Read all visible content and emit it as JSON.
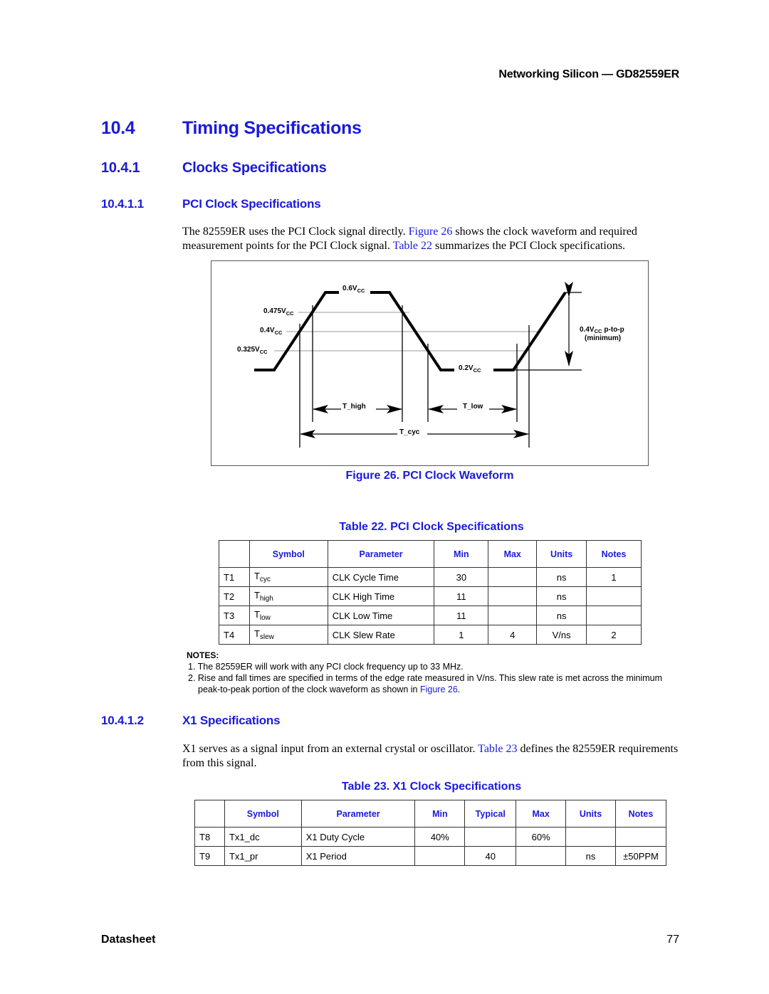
{
  "header": {
    "running_title": "Networking Silicon — GD82559ER"
  },
  "section": {
    "number": "10.4",
    "title": "Timing Specifications"
  },
  "subsection": {
    "number": "10.4.1",
    "title": "Clocks Specifications"
  },
  "subsubsections": [
    {
      "number": "10.4.1.1",
      "title": "PCI Clock Specifications",
      "paragraph": {
        "part1": "The 82559ER uses the PCI Clock signal directly. ",
        "link1": "Figure 26",
        "part2": " shows the clock waveform and required measurement points for the PCI Clock signal. ",
        "link2": "Table 22",
        "part3": " summarizes the PCI Clock specifications."
      }
    },
    {
      "number": "10.4.1.2",
      "title": "X1 Specifications",
      "paragraph": {
        "part1": "X1 serves as a signal input from an external crystal or oscillator. ",
        "link1": "Table 23",
        "part2": " defines the 82559ER requirements from this signal."
      }
    }
  ],
  "figure": {
    "caption": "Figure 26. PCI Clock Waveform",
    "labels": {
      "v_high": "0.6V",
      "v_0475": "0.475V",
      "v_04": "0.4V",
      "v_0325": "0.325V",
      "v_low": "0.2V",
      "vcc_sub": "CC",
      "p2p_line1_a": "0.4V",
      "p2p_line1_b": "p-to-p",
      "p2p_line2": "(minimum)",
      "t_high": "T_high",
      "t_low": "T_low",
      "t_cyc": "T_cyc"
    }
  },
  "table22": {
    "caption": "Table 22. PCI Clock Specifications",
    "headers": [
      "",
      "Symbol",
      "Parameter",
      "Min",
      "Max",
      "Units",
      "Notes"
    ],
    "rows": [
      {
        "id": "T1",
        "sym": "T",
        "sym_sub": "cyc",
        "param": "CLK Cycle Time",
        "min": "30",
        "max": "",
        "units": "ns",
        "notes": "1"
      },
      {
        "id": "T2",
        "sym": "T",
        "sym_sub": "high",
        "param": "CLK High Time",
        "min": "11",
        "max": "",
        "units": "ns",
        "notes": ""
      },
      {
        "id": "T3",
        "sym": "T",
        "sym_sub": "low",
        "param": "CLK Low Time",
        "min": "11",
        "max": "",
        "units": "ns",
        "notes": ""
      },
      {
        "id": "T4",
        "sym": "T",
        "sym_sub": "slew",
        "param": "CLK Slew Rate",
        "min": "1",
        "max": "4",
        "units": "V/ns",
        "notes": "2"
      }
    ]
  },
  "notes": {
    "heading": "NOTES:",
    "items": [
      {
        "text": "1. The 82559ER will work with any PCI clock frequency up to 33 MHz."
      },
      {
        "text": "2. Rise and fall times are specified in terms of the edge rate measured in V/ns. This slew rate is met across the minimum peak-to-peak portion of the clock waveform as shown in ",
        "link": "Figure 26",
        "tail": "."
      }
    ]
  },
  "table23": {
    "caption": "Table 23. X1 Clock Specifications",
    "headers": [
      "",
      "Symbol",
      "Parameter",
      "Min",
      "Typical",
      "Max",
      "Units",
      "Notes"
    ],
    "rows": [
      {
        "id": "T8",
        "sym": "Tx1_dc",
        "param": "X1 Duty Cycle",
        "min": "40%",
        "typ": "",
        "max": "60%",
        "units": "",
        "notes": ""
      },
      {
        "id": "T9",
        "sym": "Tx1_pr",
        "param": "X1 Period",
        "min": "",
        "typ": "40",
        "max": "",
        "units": "ns",
        "notes": "±50PPM"
      }
    ]
  },
  "footer": {
    "left": "Datasheet",
    "page_number": "77"
  }
}
